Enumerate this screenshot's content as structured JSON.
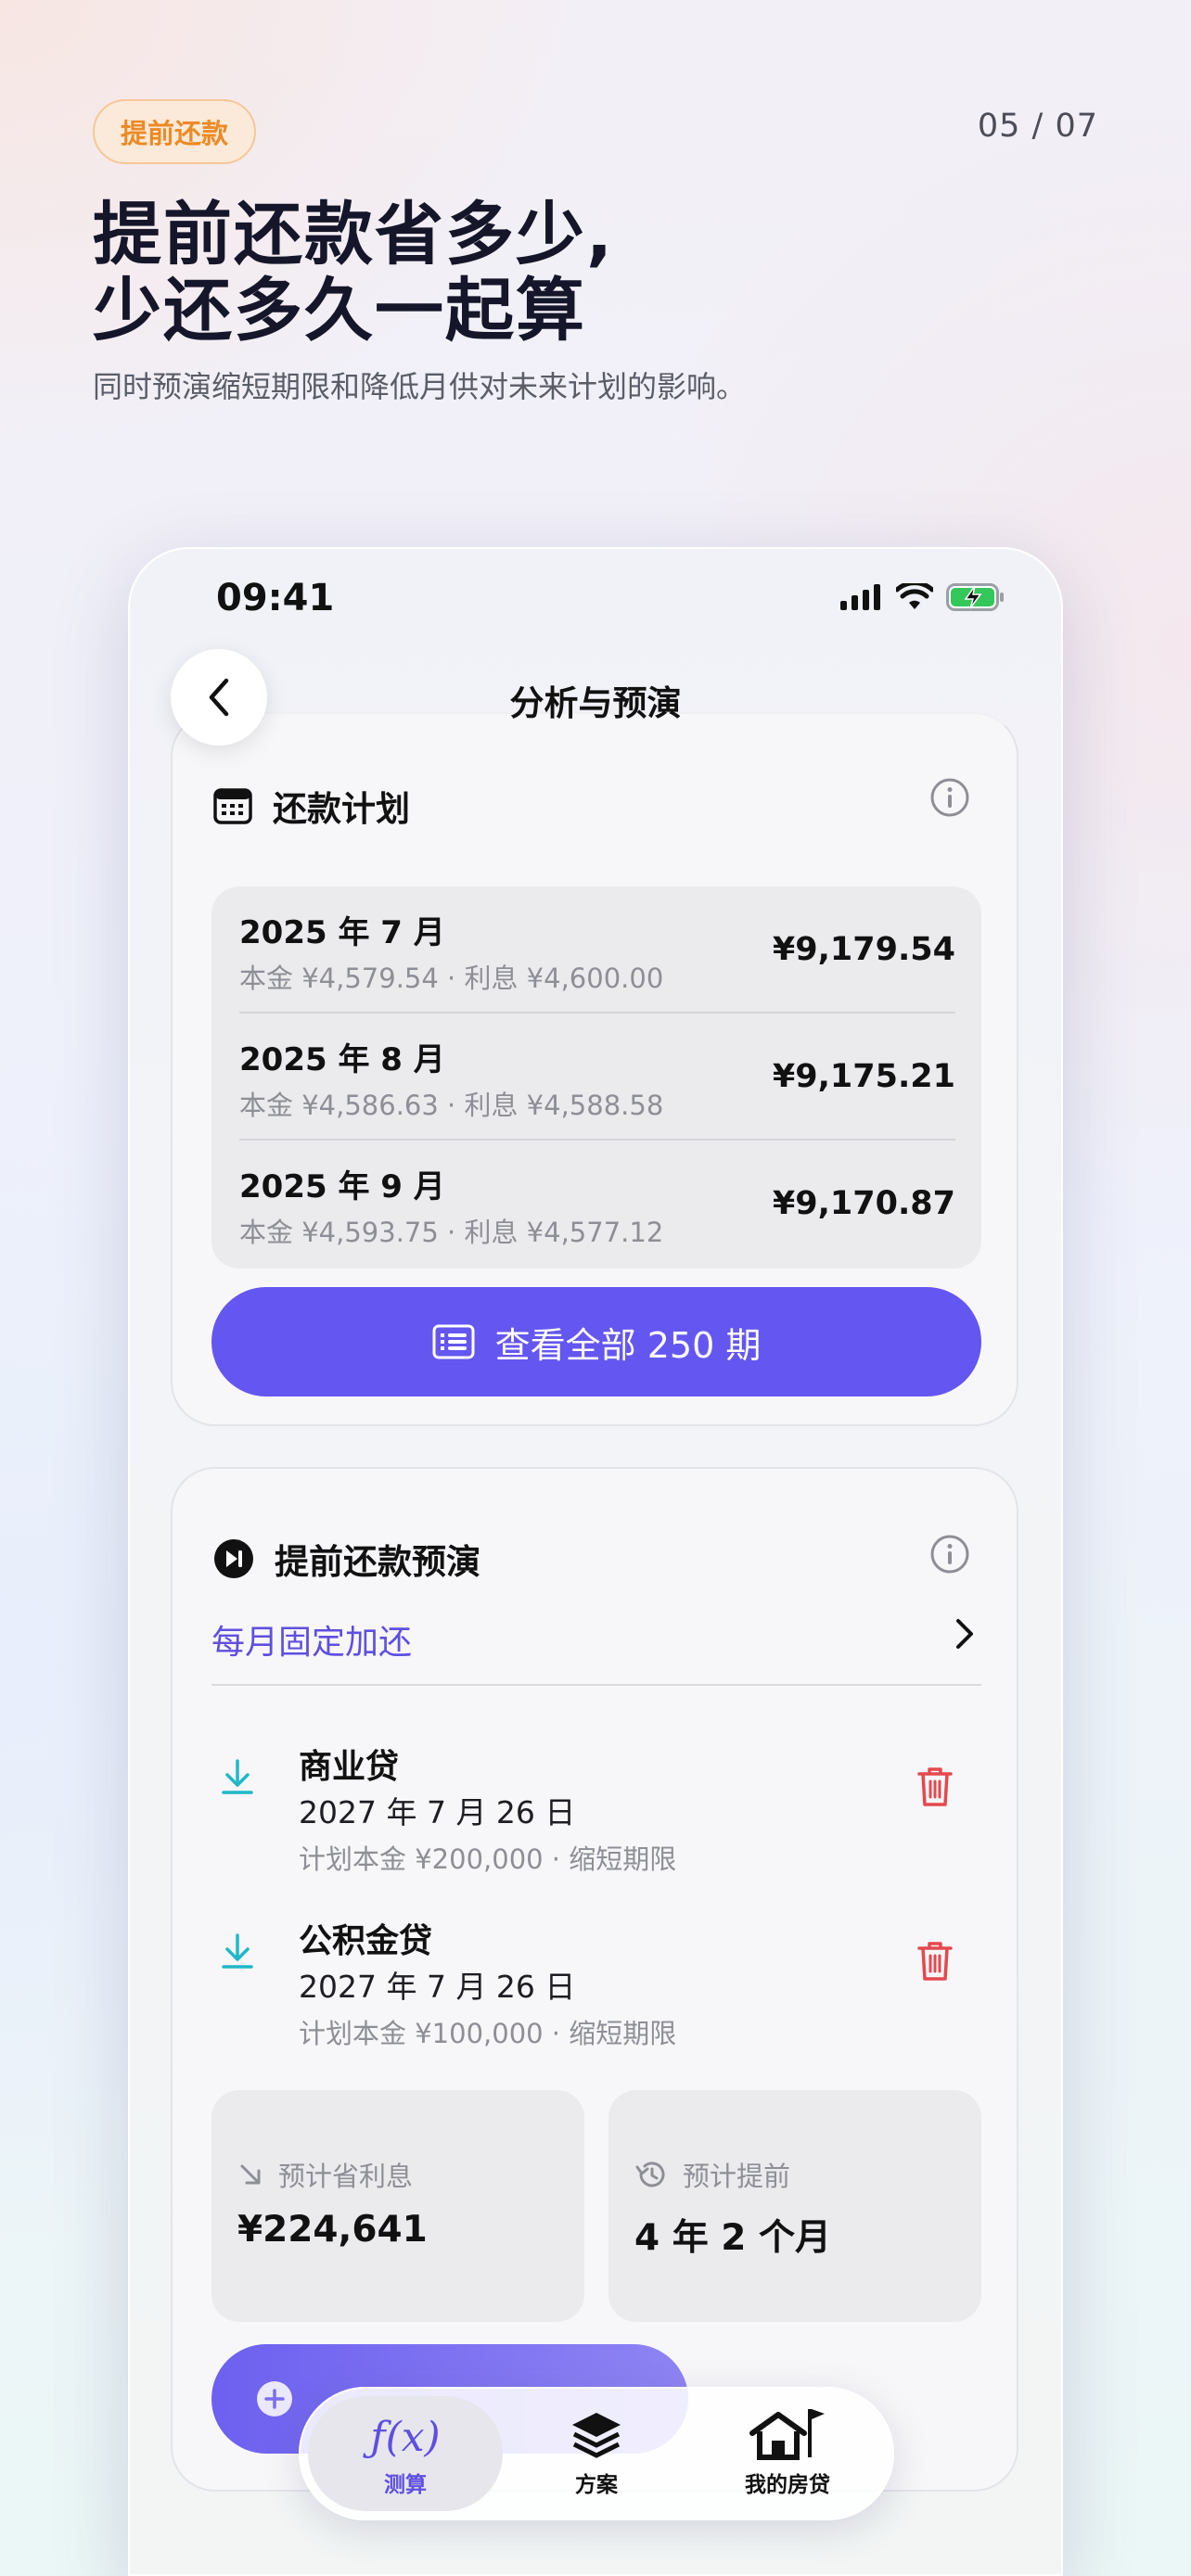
{
  "promo": {
    "tag": "提前还款",
    "page_indicator": "05 / 07",
    "headline_line1": "提前还款省多少,",
    "headline_line2": "少还多久一起算",
    "subtitle": "同时预演缩短期限和降低月供对未来计划的影响。"
  },
  "status_bar": {
    "time": "09:41"
  },
  "nav": {
    "title": "分析与预演",
    "back_icon": "chevron-left-icon"
  },
  "repayment_plan": {
    "title": "还款计划",
    "rows": [
      {
        "month": "2025 年 7 月",
        "detail": "本金 ¥4,579.54 · 利息 ¥4,600.00",
        "amount": "¥9,179.54"
      },
      {
        "month": "2025 年 8 月",
        "detail": "本金 ¥4,586.63 · 利息 ¥4,588.58",
        "amount": "¥9,175.21"
      },
      {
        "month": "2025 年 9 月",
        "detail": "本金 ¥4,593.75 · 利息 ¥4,577.12",
        "amount": "¥9,170.87"
      }
    ],
    "view_all_label": "查看全部 250 期"
  },
  "prepayment": {
    "title": "提前还款预演",
    "fixed_extra_label": "每月固定加还",
    "items": [
      {
        "name": "商业贷",
        "date": "2027 年 7 月 26 日",
        "plan": "计划本金 ¥200,000 · 缩短期限"
      },
      {
        "name": "公积金贷",
        "date": "2027 年 7 月 26 日",
        "plan": "计划本金 ¥100,000 · 缩短期限"
      }
    ],
    "stats": [
      {
        "label": "预计省利息",
        "value": "¥224,641"
      },
      {
        "label": "预计提前",
        "value": "4 年 2 个月"
      }
    ]
  },
  "tabbar": {
    "tabs": [
      {
        "label": "测算",
        "icon": "fx-icon",
        "active": true
      },
      {
        "label": "方案",
        "icon": "layers-icon",
        "active": false
      },
      {
        "label": "我的房贷",
        "icon": "house-flag-icon",
        "active": false
      }
    ]
  },
  "colors": {
    "accent": "#6456f0",
    "tag_orange": "#ec8a25",
    "delete_red": "#e5484d",
    "download_teal": "#1fb8c9"
  }
}
